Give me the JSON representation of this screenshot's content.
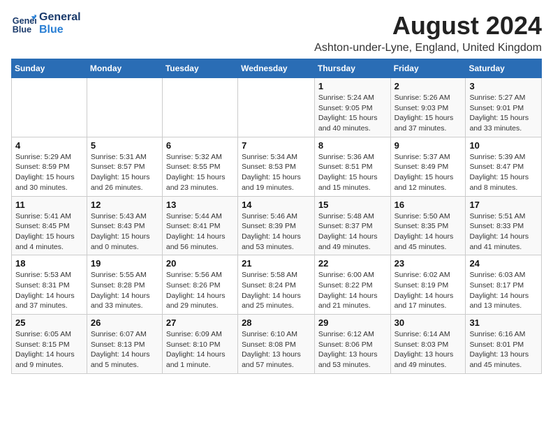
{
  "logo": {
    "line1": "General",
    "line2": "Blue"
  },
  "title": "August 2024",
  "subtitle": "Ashton-under-Lyne, England, United Kingdom",
  "days_of_week": [
    "Sunday",
    "Monday",
    "Tuesday",
    "Wednesday",
    "Thursday",
    "Friday",
    "Saturday"
  ],
  "weeks": [
    [
      {
        "day": "",
        "info": ""
      },
      {
        "day": "",
        "info": ""
      },
      {
        "day": "",
        "info": ""
      },
      {
        "day": "",
        "info": ""
      },
      {
        "day": "1",
        "info": "Sunrise: 5:24 AM\nSunset: 9:05 PM\nDaylight: 15 hours\nand 40 minutes."
      },
      {
        "day": "2",
        "info": "Sunrise: 5:26 AM\nSunset: 9:03 PM\nDaylight: 15 hours\nand 37 minutes."
      },
      {
        "day": "3",
        "info": "Sunrise: 5:27 AM\nSunset: 9:01 PM\nDaylight: 15 hours\nand 33 minutes."
      }
    ],
    [
      {
        "day": "4",
        "info": "Sunrise: 5:29 AM\nSunset: 8:59 PM\nDaylight: 15 hours\nand 30 minutes."
      },
      {
        "day": "5",
        "info": "Sunrise: 5:31 AM\nSunset: 8:57 PM\nDaylight: 15 hours\nand 26 minutes."
      },
      {
        "day": "6",
        "info": "Sunrise: 5:32 AM\nSunset: 8:55 PM\nDaylight: 15 hours\nand 23 minutes."
      },
      {
        "day": "7",
        "info": "Sunrise: 5:34 AM\nSunset: 8:53 PM\nDaylight: 15 hours\nand 19 minutes."
      },
      {
        "day": "8",
        "info": "Sunrise: 5:36 AM\nSunset: 8:51 PM\nDaylight: 15 hours\nand 15 minutes."
      },
      {
        "day": "9",
        "info": "Sunrise: 5:37 AM\nSunset: 8:49 PM\nDaylight: 15 hours\nand 12 minutes."
      },
      {
        "day": "10",
        "info": "Sunrise: 5:39 AM\nSunset: 8:47 PM\nDaylight: 15 hours\nand 8 minutes."
      }
    ],
    [
      {
        "day": "11",
        "info": "Sunrise: 5:41 AM\nSunset: 8:45 PM\nDaylight: 15 hours\nand 4 minutes."
      },
      {
        "day": "12",
        "info": "Sunrise: 5:43 AM\nSunset: 8:43 PM\nDaylight: 15 hours\nand 0 minutes."
      },
      {
        "day": "13",
        "info": "Sunrise: 5:44 AM\nSunset: 8:41 PM\nDaylight: 14 hours\nand 56 minutes."
      },
      {
        "day": "14",
        "info": "Sunrise: 5:46 AM\nSunset: 8:39 PM\nDaylight: 14 hours\nand 53 minutes."
      },
      {
        "day": "15",
        "info": "Sunrise: 5:48 AM\nSunset: 8:37 PM\nDaylight: 14 hours\nand 49 minutes."
      },
      {
        "day": "16",
        "info": "Sunrise: 5:50 AM\nSunset: 8:35 PM\nDaylight: 14 hours\nand 45 minutes."
      },
      {
        "day": "17",
        "info": "Sunrise: 5:51 AM\nSunset: 8:33 PM\nDaylight: 14 hours\nand 41 minutes."
      }
    ],
    [
      {
        "day": "18",
        "info": "Sunrise: 5:53 AM\nSunset: 8:31 PM\nDaylight: 14 hours\nand 37 minutes."
      },
      {
        "day": "19",
        "info": "Sunrise: 5:55 AM\nSunset: 8:28 PM\nDaylight: 14 hours\nand 33 minutes."
      },
      {
        "day": "20",
        "info": "Sunrise: 5:56 AM\nSunset: 8:26 PM\nDaylight: 14 hours\nand 29 minutes."
      },
      {
        "day": "21",
        "info": "Sunrise: 5:58 AM\nSunset: 8:24 PM\nDaylight: 14 hours\nand 25 minutes."
      },
      {
        "day": "22",
        "info": "Sunrise: 6:00 AM\nSunset: 8:22 PM\nDaylight: 14 hours\nand 21 minutes."
      },
      {
        "day": "23",
        "info": "Sunrise: 6:02 AM\nSunset: 8:19 PM\nDaylight: 14 hours\nand 17 minutes."
      },
      {
        "day": "24",
        "info": "Sunrise: 6:03 AM\nSunset: 8:17 PM\nDaylight: 14 hours\nand 13 minutes."
      }
    ],
    [
      {
        "day": "25",
        "info": "Sunrise: 6:05 AM\nSunset: 8:15 PM\nDaylight: 14 hours\nand 9 minutes."
      },
      {
        "day": "26",
        "info": "Sunrise: 6:07 AM\nSunset: 8:13 PM\nDaylight: 14 hours\nand 5 minutes."
      },
      {
        "day": "27",
        "info": "Sunrise: 6:09 AM\nSunset: 8:10 PM\nDaylight: 14 hours\nand 1 minute."
      },
      {
        "day": "28",
        "info": "Sunrise: 6:10 AM\nSunset: 8:08 PM\nDaylight: 13 hours\nand 57 minutes."
      },
      {
        "day": "29",
        "info": "Sunrise: 6:12 AM\nSunset: 8:06 PM\nDaylight: 13 hours\nand 53 minutes."
      },
      {
        "day": "30",
        "info": "Sunrise: 6:14 AM\nSunset: 8:03 PM\nDaylight: 13 hours\nand 49 minutes."
      },
      {
        "day": "31",
        "info": "Sunrise: 6:16 AM\nSunset: 8:01 PM\nDaylight: 13 hours\nand 45 minutes."
      }
    ]
  ]
}
